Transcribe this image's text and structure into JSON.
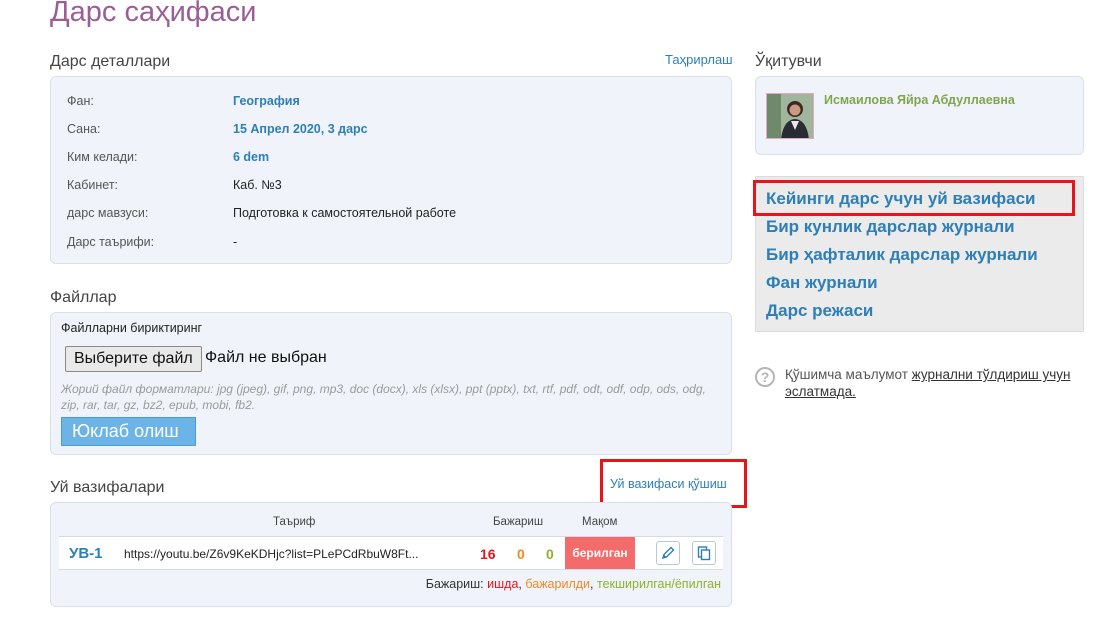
{
  "page_title": "Дарс саҳифаси",
  "details": {
    "title": "Дарс деталлари",
    "edit_link": "Таҳрирлаш",
    "rows": [
      {
        "label": "Фан:",
        "value": "География"
      },
      {
        "label": "Сана:",
        "value": "15 Апрел 2020, 3 дарс"
      },
      {
        "label": "Ким келади:",
        "value": "6 dem"
      },
      {
        "label": "Кабинет:",
        "value": "Каб. №3"
      },
      {
        "label": "дарс мавзуси:",
        "value": "Подготовка к самостоятельной работе"
      },
      {
        "label": "Дарс таърифи:",
        "value": "-"
      }
    ]
  },
  "files": {
    "title": "Файллар",
    "attach_label": "Файлларни бириктиринг",
    "choose_button": "Выберите файл",
    "no_file": "Файл не выбран",
    "formats": "Жорий файл форматлари: jpg (jpeg), gif, png, mp3, doc (docx), xls (xlsx), ppt (pptx), txt, rtf, pdf, odt, odf, odp, ods, odg, zip, rar, tar, gz, bz2, epub, mobi, fb2.",
    "upload_button": "Юклаб олиш"
  },
  "homework": {
    "title": "Уй вазифалари",
    "add_link": "Уй вазифаси қўшиш",
    "headers": {
      "description": "Таъриф",
      "execution": "Бажариш",
      "status": "Мақом"
    },
    "rows": [
      {
        "id": "УВ-1",
        "url": "https://youtu.be/Z6v9KeKDHjc?list=PLePCdRbuW8Ft...",
        "count_red": "16",
        "count_orange": "0",
        "count_green": "0",
        "status": "берилган",
        "edit_icon": "pencil-icon",
        "copy_icon": "copy-icon"
      }
    ],
    "legend": {
      "prefix": "Бажариш:",
      "red": "ишда",
      "sep1": ",",
      "orange": "бажарилди",
      "sep2": ",",
      "green": "текширилган/ёпилган"
    }
  },
  "teacher": {
    "title": "Ўқитувчи",
    "name": "Исмаилова Яйра Абдуллаевна"
  },
  "nav_links": [
    "Кейинги дарс учун уй вазифаси",
    "Бир кунлик дарслар журнали",
    "Бир ҳафталик дарслар журнали",
    "Фан журнали",
    "Дарс режаси"
  ],
  "info": {
    "icon": "?",
    "text": "Қўшимча маълумот",
    "link": "журнални тўлдириш учун эслатмада."
  },
  "colors": {
    "title": "#9b5d95",
    "link": "#2d7fb6",
    "status_red": "#f36b6b",
    "count_red": "#e8141c",
    "count_orange": "#f08a24",
    "count_green": "#8db32a",
    "highlight": "#e8141c"
  }
}
